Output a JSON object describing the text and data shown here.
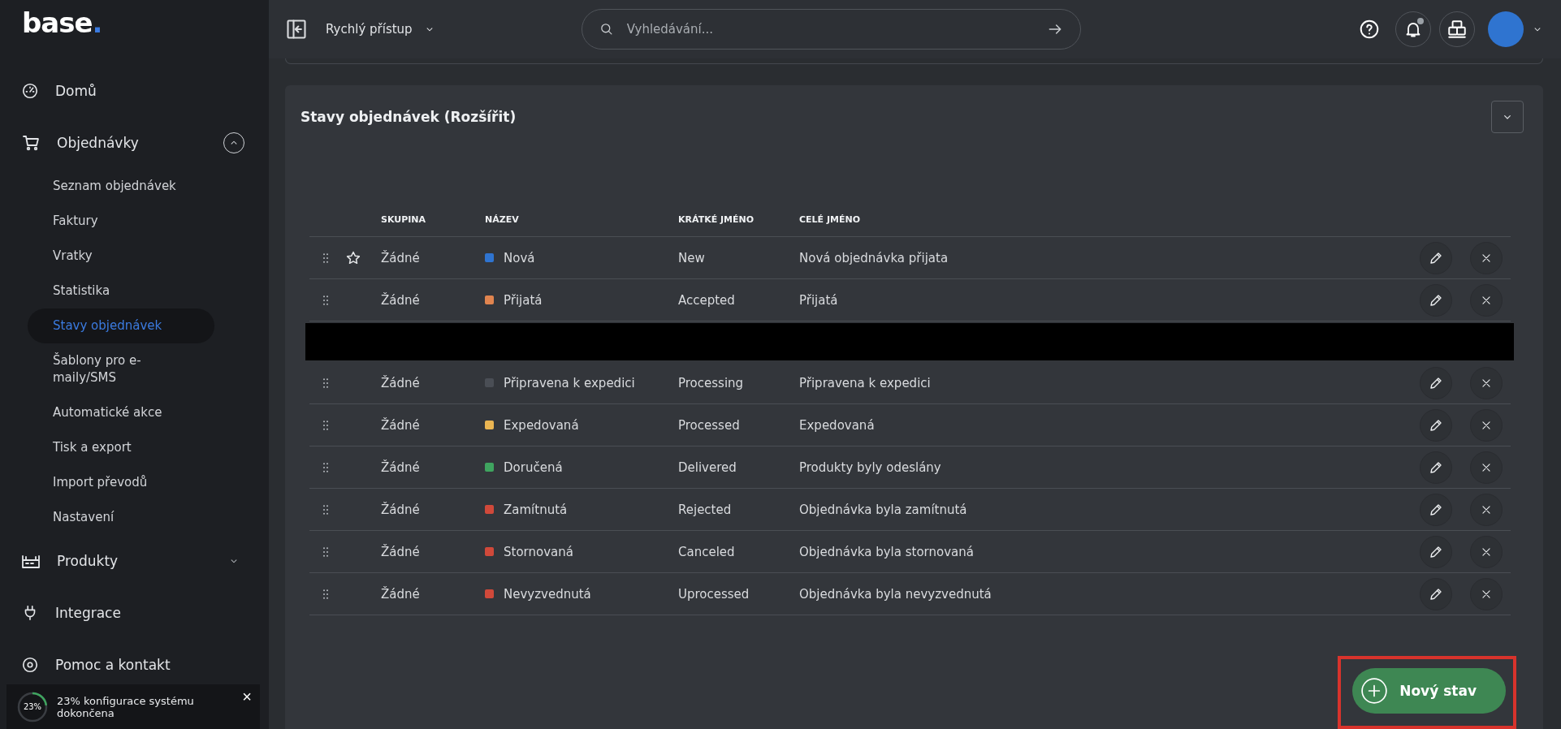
{
  "logo": {
    "word": "base",
    "dot": "."
  },
  "sidebar": {
    "items": [
      {
        "label": "Domů"
      },
      {
        "label": "Objednávky",
        "expanded": true,
        "children": [
          {
            "label": "Seznam objednávek",
            "selected": false
          },
          {
            "label": "Faktury",
            "selected": false
          },
          {
            "label": "Vratky",
            "selected": false
          },
          {
            "label": "Statistika",
            "selected": false
          },
          {
            "label": "Stavy objednávek",
            "selected": true
          },
          {
            "label": "Šablony pro e-maily/SMS",
            "selected": false
          },
          {
            "label": "Automatické akce",
            "selected": false
          },
          {
            "label": "Tisk a export",
            "selected": false
          },
          {
            "label": "Import převodů",
            "selected": false
          },
          {
            "label": "Nastavení",
            "selected": false
          }
        ]
      },
      {
        "label": "Produkty",
        "expanded": false
      },
      {
        "label": "Integrace"
      },
      {
        "label": "Pomoc a kontakt"
      }
    ]
  },
  "toast": {
    "progress": "23%",
    "level": 0.23,
    "message": "23% konfigurace systému dokončena",
    "close": "×"
  },
  "topbar": {
    "quick_access": "Rychlý přístup",
    "search": {
      "placeholder": "Vyhledávání..."
    },
    "notifications_unread": true
  },
  "card": {
    "title": "Stavy objednávek (Rozšířit)",
    "expanded": false,
    "columns": [
      "SKUPINA",
      "NÁZEV",
      "KRÁTKÉ JMÉNO",
      "CELÉ JMÉNO"
    ],
    "rows": [
      {
        "kind": "status",
        "default": true,
        "group": "Žádné",
        "name": "Nová",
        "color": "#2f74d0",
        "short": "New",
        "full": "Nová objednávka přijata"
      },
      {
        "kind": "status",
        "default": false,
        "group": "Žádné",
        "name": "Přijatá",
        "color": "#e0844f",
        "short": "Accepted",
        "full": "Přijatá"
      },
      {
        "kind": "redacted"
      },
      {
        "kind": "status",
        "default": false,
        "group": "Žádné",
        "name": "Připravena k expedici",
        "color": "#4a4e55",
        "short": "Processing",
        "full": "Připravena k expedici"
      },
      {
        "kind": "status",
        "default": false,
        "group": "Žádné",
        "name": "Expedovaná",
        "color": "#eab552",
        "short": "Processed",
        "full": "Expedovaná"
      },
      {
        "kind": "status",
        "default": false,
        "group": "Žádné",
        "name": "Doručená",
        "color": "#3fa45f",
        "short": "Delivered",
        "full": "Produkty byly odeslány"
      },
      {
        "kind": "status",
        "default": false,
        "group": "Žádné",
        "name": "Zamítnutá",
        "color": "#d0493a",
        "short": "Rejected",
        "full": "Objednávka byla zamítnutá"
      },
      {
        "kind": "status",
        "default": false,
        "group": "Žádné",
        "name": "Stornovaná",
        "color": "#d0493a",
        "short": "Canceled",
        "full": "Objednávka byla stornovaná"
      },
      {
        "kind": "status",
        "default": false,
        "group": "Žádné",
        "name": "Nevyzvednutá",
        "color": "#d0493a",
        "short": "Uprocessed",
        "full": "Objednávka byla nevyzvednutá"
      }
    ],
    "new_button": {
      "label": "Nový stav",
      "highlighted": true
    }
  }
}
